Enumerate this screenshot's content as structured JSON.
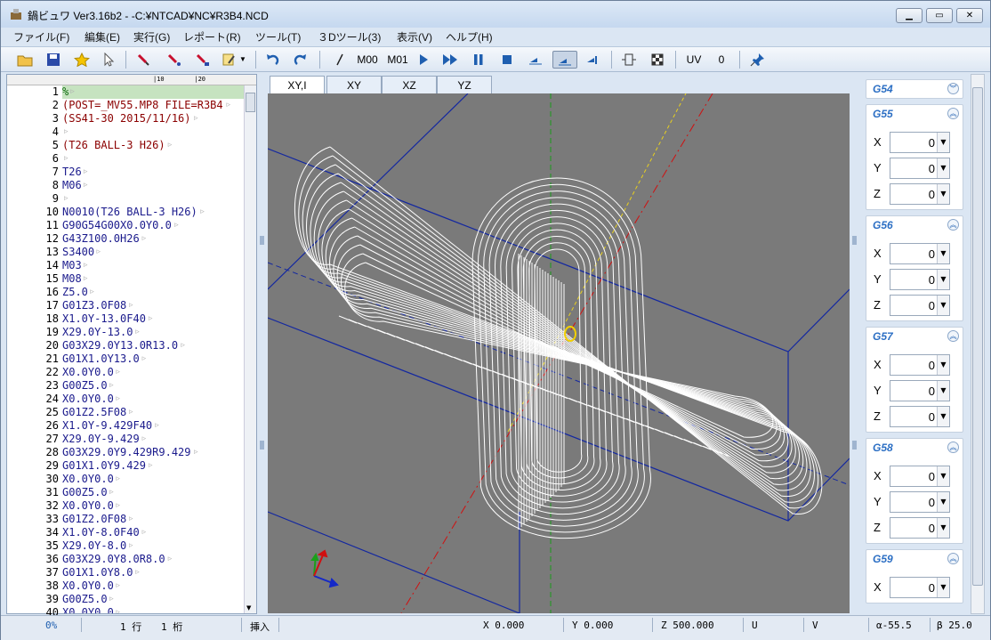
{
  "window": {
    "title": "鍋ビュワ Ver3.16b2 - -C:¥NTCAD¥NC¥R3B4.NCD"
  },
  "menu": [
    "ファイル(F)",
    "編集(E)",
    "実行(G)",
    "レポート(R)",
    "ツール(T)",
    "３Dツール(3)",
    "表示(V)",
    "ヘルプ(H)"
  ],
  "toolbar": {
    "m00": "M00",
    "m01": "M01",
    "uv": "UV",
    "uv_value": "0"
  },
  "editor": {
    "ruler": "|10        |20",
    "lines": [
      "%",
      "(POST=_MV55.MP8 FILE=R3B4",
      "(SS41-30 2015/11/16)",
      "",
      "(T26 BALL-3 H26)",
      "",
      "T26",
      "M06",
      "",
      "N0010(T26 BALL-3 H26)",
      "G90G54G00X0.0Y0.0",
      "G43Z100.0H26",
      "S3400",
      "M03",
      "M08",
      "Z5.0",
      "G01Z3.0F08",
      "X1.0Y-13.0F40",
      "X29.0Y-13.0",
      "G03X29.0Y13.0R13.0",
      "G01X1.0Y13.0",
      "X0.0Y0.0",
      "G00Z5.0",
      "X0.0Y0.0",
      "G01Z2.5F08",
      "X1.0Y-9.429F40",
      "X29.0Y-9.429",
      "G03X29.0Y9.429R9.429",
      "G01X1.0Y9.429",
      "X0.0Y0.0",
      "G00Z5.0",
      "X0.0Y0.0",
      "G01Z2.0F08",
      "X1.0Y-8.0F40",
      "X29.0Y-8.0",
      "G03X29.0Y8.0R8.0",
      "G01X1.0Y8.0",
      "X0.0Y0.0",
      "G00Z5.0",
      "X0.0Y0.0"
    ]
  },
  "tabs": [
    "XY,I",
    "XY",
    "XZ",
    "YZ"
  ],
  "offsets": [
    {
      "name": "G54",
      "collapsed": true
    },
    {
      "name": "G55",
      "x": "0",
      "y": "0",
      "z": "0"
    },
    {
      "name": "G56",
      "x": "0",
      "y": "0",
      "z": "0"
    },
    {
      "name": "G57",
      "x": "0",
      "y": "0",
      "z": "0"
    },
    {
      "name": "G58",
      "x": "0",
      "y": "0",
      "z": "0"
    },
    {
      "name": "G59",
      "x": "0"
    }
  ],
  "axis_labels": {
    "x": "X",
    "y": "Y",
    "z": "Z"
  },
  "status": {
    "progress": "0%",
    "row": "1 行",
    "col": "1 桁",
    "mode": "挿入",
    "x": "X 0.000",
    "y": "Y 0.000",
    "z": "Z 500.000",
    "u": "U",
    "v": "V",
    "alpha": "α-55.5",
    "beta": "β 25.0"
  }
}
